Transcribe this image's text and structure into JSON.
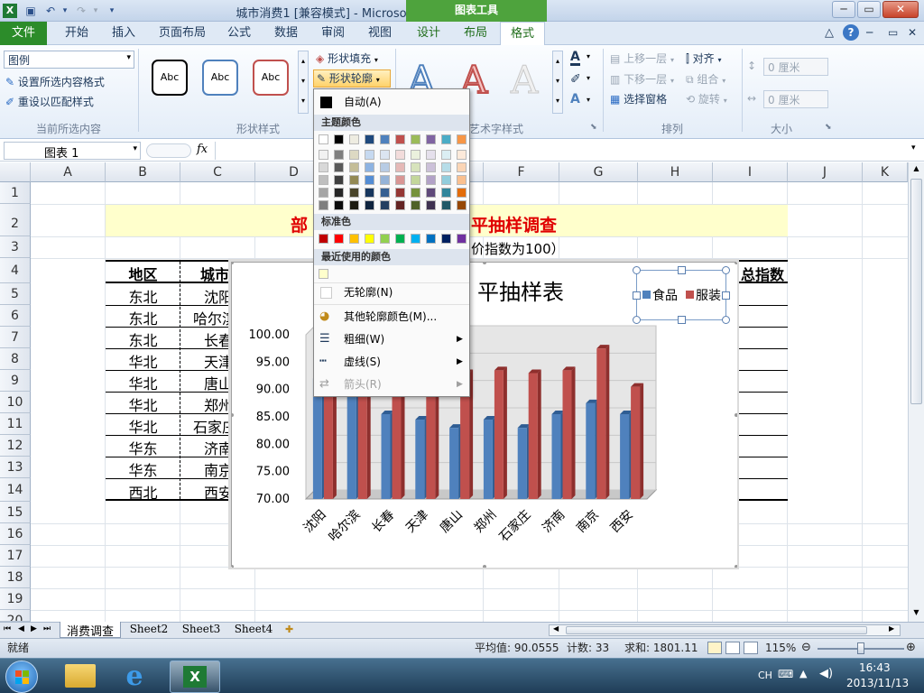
{
  "window": {
    "title": "城市消费1 [兼容模式] - Microsoft Excel",
    "context_tab_group": "图表工具"
  },
  "tabs": {
    "file": "文件",
    "items": [
      "开始",
      "插入",
      "页面布局",
      "公式",
      "数据",
      "审阅",
      "视图",
      "设计",
      "布局",
      "格式"
    ],
    "active": "格式"
  },
  "ribbon": {
    "current_selection": {
      "select_value": "图例",
      "format_selection": "设置所选内容格式",
      "reset_style": "重设以匹配样式",
      "label": "当前所选内容"
    },
    "shape_styles": {
      "sample_text": "Abc",
      "fill": "形状填充",
      "outline": "形状轮廓",
      "label": "形状样式"
    },
    "wordart": {
      "label": "艺术字样式"
    },
    "arrange": {
      "bring_forward": "上移一层",
      "send_backward": "下移一层",
      "selection_pane": "选择窗格",
      "align": "对齐",
      "group": "组合",
      "rotate": "旋转",
      "label": "排列"
    },
    "size": {
      "height": "0 厘米",
      "width": "0 厘米",
      "label": "大小"
    }
  },
  "formula_bar": {
    "name_box": "图表 1",
    "fx": "fx",
    "value": ""
  },
  "columns": [
    "A",
    "B",
    "C",
    "D",
    "E",
    "F",
    "G",
    "H",
    "I",
    "J",
    "K"
  ],
  "rows": [
    "1",
    "2",
    "3",
    "4",
    "5",
    "6",
    "7",
    "8",
    "9",
    "10",
    "11",
    "12",
    "13",
    "14",
    "15",
    "16",
    "17",
    "18",
    "19",
    "20"
  ],
  "sheet": {
    "title_visible": "部",
    "title_right": "平抽样调查",
    "subtitle": "价指数为100）",
    "header_region": "地区",
    "header_city": "城市",
    "header_index": "总指数",
    "regions": [
      "东北",
      "东北",
      "东北",
      "华北",
      "华北",
      "华北",
      "华北",
      "华东",
      "华东",
      "西北"
    ],
    "cities": [
      "沈阳",
      "哈尔滨",
      "长春",
      "天津",
      "唐山",
      "郑州",
      "石家庄",
      "济南",
      "南京",
      "西安"
    ]
  },
  "chart_data": {
    "type": "bar",
    "title": "平抽样表",
    "categories": [
      "沈阳",
      "哈尔滨",
      "长春",
      "天津",
      "唐山",
      "郑州",
      "石家庄",
      "济南",
      "南京",
      "西安"
    ],
    "series": [
      {
        "name": "食品",
        "color": "#4f81bd",
        "values": [
          92.0,
          91.5,
          85.5,
          84.5,
          83.0,
          84.5,
          83.0,
          85.5,
          87.5,
          85.5
        ]
      },
      {
        "name": "服装",
        "color": "#c0504d",
        "values": [
          93.0,
          92.5,
          90.0,
          89.5,
          93.0,
          93.5,
          93.0,
          93.5,
          97.5,
          90.5
        ]
      }
    ],
    "yticks": [
      "100.00",
      "95.00",
      "90.00",
      "85.00",
      "80.00",
      "75.00",
      "70.00"
    ],
    "ylim": [
      70,
      100
    ],
    "legend_position": "top-right"
  },
  "dropdown": {
    "auto": "自动(A)",
    "theme_colors": "主题颜色",
    "standard_colors": "标准色",
    "recent_colors": "最近使用的颜色",
    "no_outline": "无轮廓(N)",
    "more_colors": "其他轮廓颜色(M)...",
    "weight": "粗细(W)",
    "dashes": "虚线(S)",
    "arrows": "箭头(R)",
    "theme_top": [
      "#ffffff",
      "#000000",
      "#eeece1",
      "#1f497d",
      "#4f81bd",
      "#c0504d",
      "#9bbb59",
      "#8064a2",
      "#4bacc6",
      "#f79646"
    ],
    "theme_shades": [
      [
        "#f2f2f2",
        "#7f7f7f",
        "#ddd9c3",
        "#c6d9f0",
        "#dbe5f1",
        "#f2dcdb",
        "#ebf1dd",
        "#e5e0ec",
        "#dbeef3",
        "#fdeada"
      ],
      [
        "#d8d8d8",
        "#595959",
        "#c4bd97",
        "#8db3e2",
        "#b8cce4",
        "#e5b9b7",
        "#d7e3bc",
        "#ccc1d9",
        "#b7dde8",
        "#fbd5b5"
      ],
      [
        "#bfbfbf",
        "#3f3f3f",
        "#938953",
        "#548dd4",
        "#95b3d7",
        "#d99694",
        "#c3d69b",
        "#b2a2c7",
        "#92cddc",
        "#fac08f"
      ],
      [
        "#a5a5a5",
        "#262626",
        "#494429",
        "#17365d",
        "#366092",
        "#953734",
        "#76923c",
        "#5f497a",
        "#31859b",
        "#e36c09"
      ],
      [
        "#7f7f7f",
        "#0c0c0c",
        "#1d1b10",
        "#0f243e",
        "#244061",
        "#632423",
        "#4f6128",
        "#3f3151",
        "#205867",
        "#974806"
      ]
    ],
    "standard": [
      "#c00000",
      "#ff0000",
      "#ffc000",
      "#ffff00",
      "#92d050",
      "#00b050",
      "#00b0f0",
      "#0070c0",
      "#002060",
      "#7030a0"
    ],
    "recent": [
      "#ffffcc"
    ]
  },
  "sheet_tabs": [
    "消费调查",
    "Sheet2",
    "Sheet3",
    "Sheet4"
  ],
  "status": {
    "ready": "就绪",
    "average": "平均值: 90.0555",
    "count": "计数: 33",
    "sum": "求和: 1801.11",
    "zoom": "115%"
  },
  "taskbar": {
    "lang": "CH",
    "time": "16:43",
    "date": "2013/11/13"
  }
}
